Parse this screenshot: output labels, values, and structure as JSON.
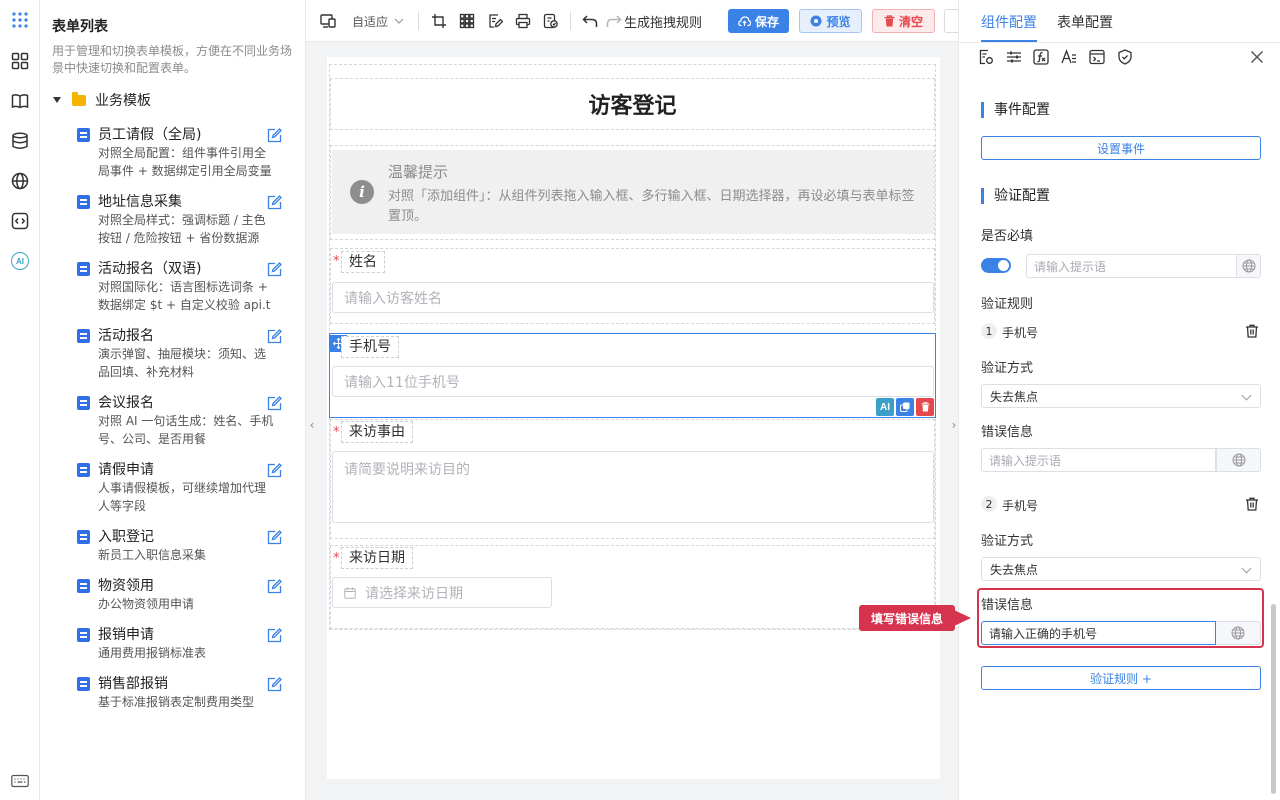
{
  "sidebar": {
    "title": "表单列表",
    "description": "用于管理和切换表单模板，方便在不同业务场景中快速切换和配置表单。",
    "folder": "业务模板",
    "items": [
      {
        "name": "员工请假（全局)",
        "desc": "对照全局配置：组件事件引用全局事件 + 数据绑定引用全局变量"
      },
      {
        "name": "地址信息采集",
        "desc": "对照全局样式：强调标题 / 主色按钮 / 危险按钮 + 省份数据源"
      },
      {
        "name": "活动报名（双语)",
        "desc": "对照国际化：语言图标选词条 + 数据绑定 $t + 自定义校验 api.t"
      },
      {
        "name": "活动报名",
        "desc": "演示弹窗、抽屉模块：须知、选品回填、补充材料"
      },
      {
        "name": "会议报名",
        "desc": "对照 AI 一句话生成：姓名、手机号、公司、是否用餐"
      },
      {
        "name": "请假申请",
        "desc": "人事请假模板，可继续增加代理人等字段"
      },
      {
        "name": "入职登记",
        "desc": "新员工入职信息采集"
      },
      {
        "name": "物资领用",
        "desc": "办公物资领用申请"
      },
      {
        "name": "报销申请",
        "desc": "通用费用报销标准表"
      },
      {
        "name": "销售部报销",
        "desc": "基于标准报销表定制费用类型"
      }
    ]
  },
  "toolbar": {
    "layout_mode": "自适应",
    "generate_rules": "生成拖拽规则",
    "save": "保存",
    "preview": "预览",
    "clear": "清空"
  },
  "form": {
    "title": "访客登记",
    "tip_title": "温馨提示",
    "tip_body": "对照「添加组件」：从组件列表拖入输入框、多行输入框、日期选择器，再设必填与表单标签置顶。",
    "fields": {
      "name": {
        "label": "姓名",
        "placeholder": "请输入访客姓名"
      },
      "phone": {
        "label": "手机号",
        "placeholder": "请输入11位手机号"
      },
      "reason": {
        "label": "来访事由",
        "placeholder": "请简要说明来访目的"
      },
      "date": {
        "label": "来访日期",
        "placeholder": "请选择来访日期"
      }
    },
    "ai_label": "AI"
  },
  "panel": {
    "tabs": [
      "组件配置",
      "表单配置"
    ],
    "event_section": "事件配置",
    "set_event": "设置事件",
    "validate_section": "验证配置",
    "required_label": "是否必填",
    "required_placeholder": "请输入提示语",
    "rules_label": "验证规则",
    "rules": [
      {
        "index": "1",
        "name": "手机号",
        "method_label": "验证方式",
        "method": "失去焦点",
        "error_label": "错误信息",
        "error_value": "",
        "error_placeholder": "请输入提示语"
      },
      {
        "index": "2",
        "name": "手机号",
        "method_label": "验证方式",
        "method": "失去焦点",
        "error_label": "错误信息",
        "error_value": "请输入正确的手机号",
        "error_placeholder": ""
      }
    ],
    "add_rule": "验证规则 +",
    "callout": "填写错误信息"
  },
  "colors": {
    "primary": "#3b82e6",
    "danger": "#e5484d",
    "highlight": "#d6334e"
  }
}
